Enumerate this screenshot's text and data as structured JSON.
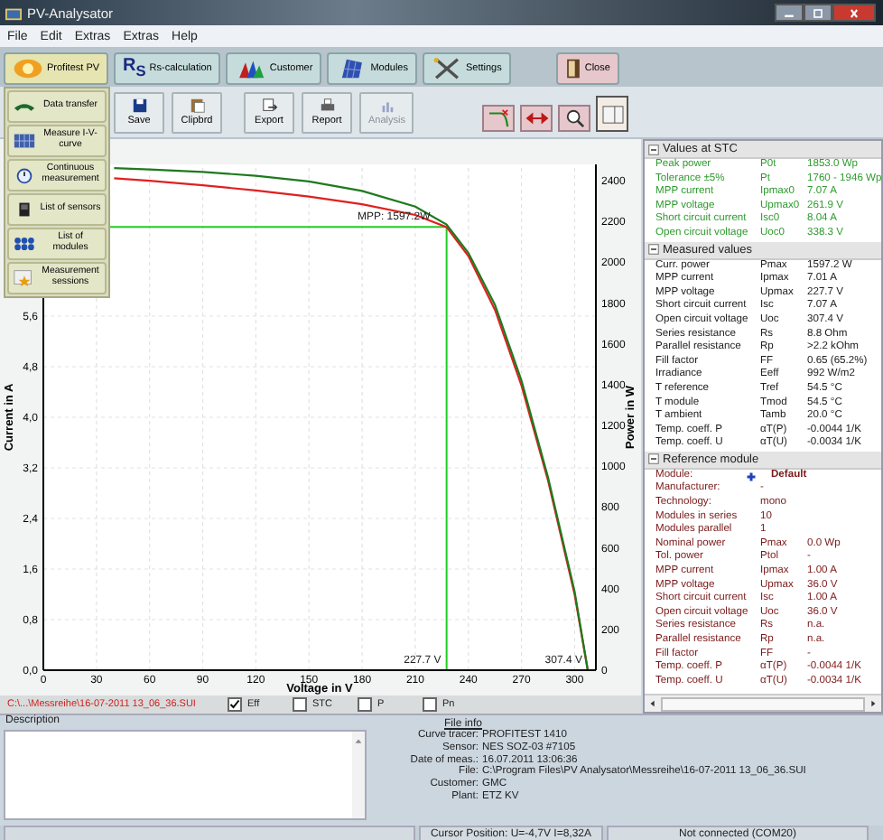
{
  "window": {
    "title": "PV-Analysator"
  },
  "menu": [
    "File",
    "Edit",
    "Extras",
    "Extras",
    "Help"
  ],
  "main_tabs": [
    {
      "label": "Profitest PV",
      "kind": "tab",
      "selected": true
    },
    {
      "label": "Rs-calculation",
      "icon_text": "R$_{S}$",
      "kind": "tab",
      "selected": false
    },
    {
      "label": "Customer",
      "kind": "tab",
      "selected": false
    },
    {
      "label": "Modules",
      "kind": "tab",
      "selected": false
    },
    {
      "label": "Settings",
      "kind": "tab",
      "selected": false
    },
    {
      "label": "Close",
      "kind": "close",
      "selected": false
    }
  ],
  "side_menu": [
    {
      "label": "Data transfer"
    },
    {
      "label": "Measure I-V-curve"
    },
    {
      "label": "Continuous measurement"
    },
    {
      "label": "List of sensors"
    },
    {
      "label": "List of modules"
    },
    {
      "label": "Measurement sessions"
    }
  ],
  "toolbar": [
    {
      "label": "Save",
      "disabled": false
    },
    {
      "label": "Clipbrd",
      "disabled": false
    },
    {
      "label": "Export",
      "disabled": false
    },
    {
      "label": "Report",
      "disabled": false
    },
    {
      "label": "Analysis",
      "disabled": true
    }
  ],
  "view_buttons": [
    {
      "selected": false
    },
    {
      "selected": false
    },
    {
      "selected": false
    },
    {
      "selected": true
    }
  ],
  "chart": {
    "chart_data": {
      "type": "line",
      "xlabel": "Voltage in V",
      "ylabel": "Current in A",
      "x": [
        40,
        60,
        90,
        120,
        150,
        180,
        210,
        227.7,
        240,
        255,
        270,
        285,
        300,
        307.4
      ],
      "series": [
        {
          "color": "#e02020",
          "values": [
            7.78,
            7.74,
            7.67,
            7.59,
            7.49,
            7.37,
            7.2,
            7.01,
            6.55,
            5.7,
            4.5,
            3.0,
            1.2,
            0
          ]
        },
        {
          "color": "#1e7a1e",
          "values": [
            7.94,
            7.92,
            7.88,
            7.82,
            7.73,
            7.58,
            7.33,
            7.05,
            6.6,
            5.78,
            4.58,
            3.05,
            1.25,
            0
          ]
        }
      ],
      "xlim": [
        0,
        312
      ],
      "ylim": [
        0,
        8
      ],
      "grid": true,
      "xticks": [
        0,
        30,
        60,
        90,
        120,
        150,
        180,
        210,
        240,
        270,
        300
      ],
      "yticks": [
        {
          "value": 0,
          "label": "0,0"
        },
        {
          "value": 0.8,
          "label": "0,8"
        },
        {
          "value": 1.6,
          "label": "1,6"
        },
        {
          "value": 2.4,
          "label": "2,4"
        },
        {
          "value": 3.2,
          "label": "3,2"
        },
        {
          "value": 4.0,
          "label": "4,0"
        },
        {
          "value": 4.8,
          "label": "4,8"
        },
        {
          "value": 5.6,
          "label": "5,6"
        }
      ],
      "ref_lines": [
        {
          "axis": "y",
          "value": 7.01,
          "color": "#22cc22"
        },
        {
          "axis": "x",
          "value": 227.7,
          "color": "#22cc22"
        }
      ],
      "annotations": [
        "MPP: 1597.2W",
        "227.7 V",
        "307.4 V"
      ]
    },
    "power_axis": {
      "title": "Power in W",
      "ticks": [
        "2400",
        "2200",
        "2000",
        "1800",
        "1600",
        "1400",
        "1200",
        "1000",
        "800",
        "600",
        "400",
        "200",
        "0"
      ]
    }
  },
  "file_bar": {
    "path": "C:\\...\\Messreihe\\16-07-2011 13_06_36.SUI",
    "options": [
      {
        "label": "Eff",
        "checked": true
      },
      {
        "label": "STC",
        "checked": false
      },
      {
        "label": "P",
        "checked": false
      },
      {
        "label": "Pn",
        "checked": false
      }
    ]
  },
  "properties": {
    "sections": [
      {
        "title": "Values at STC",
        "expanded": true,
        "color": "#2f9a2f",
        "rows": [
          {
            "label": "Peak power",
            "symbol": "P0t",
            "value": "1853.0 Wp"
          },
          {
            "label": "Tolerance ±5%",
            "symbol": "Pt",
            "value": "1760 - 1946 Wp"
          },
          {
            "label": "MPP current",
            "symbol": "Ipmax0",
            "value": "7.07 A"
          },
          {
            "label": "MPP voltage",
            "symbol": "Upmax0",
            "value": "261.9 V"
          },
          {
            "label": "Short circuit current",
            "symbol": "Isc0",
            "value": "8.04 A"
          },
          {
            "label": "Open circuit voltage",
            "symbol": "Uoc0",
            "value": "338.3 V"
          }
        ]
      },
      {
        "title": "Measured values",
        "expanded": true,
        "color": "#202020",
        "rows": [
          {
            "label": "Curr. power",
            "symbol": "Pmax",
            "value": "1597.2 W"
          },
          {
            "label": "MPP current",
            "symbol": "Ipmax",
            "value": "7.01 A"
          },
          {
            "label": "MPP voltage",
            "symbol": "Upmax",
            "value": "227.7 V"
          },
          {
            "label": "Short circuit current",
            "symbol": "Isc",
            "value": "7.07 A"
          },
          {
            "label": "Open circuit voltage",
            "symbol": "Uoc",
            "value": "307.4 V"
          },
          {
            "label": "Series resistance",
            "symbol": "Rs",
            "value": "8.8 Ohm"
          },
          {
            "label": "Parallel resistance",
            "symbol": "Rp",
            "value": ">2.2 kOhm"
          },
          {
            "label": "Fill factor",
            "symbol": "FF",
            "value": "0.65 (65.2%)"
          },
          {
            "label": "Irradiance",
            "symbol": "Eeff",
            "value": "992 W/m2"
          },
          {
            "label": "T reference",
            "symbol": "Tref",
            "value": "54.5 °C"
          },
          {
            "label": "T module",
            "symbol": "Tmod",
            "value": "54.5 °C"
          },
          {
            "label": "T ambient",
            "symbol": "Tamb",
            "value": "20.0 °C"
          },
          {
            "label": "Temp. coeff. P",
            "symbol": "αT(P)",
            "value": "-0.0044 1/K"
          },
          {
            "label": "Temp. coeff. U",
            "symbol": "αT(U)",
            "value": "-0.0034 1/K"
          }
        ]
      },
      {
        "title": "Reference module",
        "expanded": true,
        "color": "#7a1818",
        "rows": [
          {
            "kind": "module",
            "label": "Module:",
            "value": "Default"
          },
          {
            "label": "Manufacturer:",
            "value": "-"
          },
          {
            "label": "Technology:",
            "value": "mono"
          },
          {
            "label": "Modules in series",
            "value": "10"
          },
          {
            "label": "Modules parallel",
            "value": "1"
          },
          {
            "label": "Nominal power",
            "symbol": "Pmax",
            "value": "0.0 Wp"
          },
          {
            "label": "Tol. power",
            "symbol": "Ptol",
            "value": "-"
          },
          {
            "label": "MPP current",
            "symbol": "Ipmax",
            "value": "1.00 A"
          },
          {
            "label": "MPP voltage",
            "symbol": "Upmax",
            "value": "36.0 V"
          },
          {
            "label": "Short circuit current",
            "symbol": "Isc",
            "value": "1.00 A"
          },
          {
            "label": "Open circuit voltage",
            "symbol": "Uoc",
            "value": "36.0 V"
          },
          {
            "label": "Series resistance",
            "symbol": "Rs",
            "value": "n.a."
          },
          {
            "label": "Parallel resistance",
            "symbol": "Rp",
            "value": "n.a."
          },
          {
            "label": "Fill factor",
            "symbol": "FF",
            "value": "-"
          },
          {
            "label": "Temp. coeff. P",
            "symbol": "αT(P)",
            "value": "-0.0044 1/K"
          },
          {
            "label": "Temp. coeff. U",
            "symbol": "αT(U)",
            "value": "-0.0034 1/K"
          }
        ]
      }
    ]
  },
  "description": {
    "label": "Description"
  },
  "file_info": {
    "title": "File info",
    "rows": [
      {
        "label": "Curve tracer:",
        "value": "PROFITEST 1410"
      },
      {
        "label": "Sensor:",
        "value": "NES SOZ-03 #7105"
      },
      {
        "label": "Date of meas.:",
        "value": "16.07.2011 13:06:36"
      },
      {
        "label": "File:",
        "value": "C:\\Program Files\\PV Analysator\\Messreihe\\16-07-2011 13_06_36.SUI"
      },
      {
        "label": "Customer:",
        "value": "GMC"
      },
      {
        "label": "Plant:",
        "value": "ETZ KV"
      }
    ]
  },
  "status_bar": {
    "cursor": "Cursor Position: U=-4,7V I=8,32A",
    "connection": "Not connected (COM20)"
  }
}
